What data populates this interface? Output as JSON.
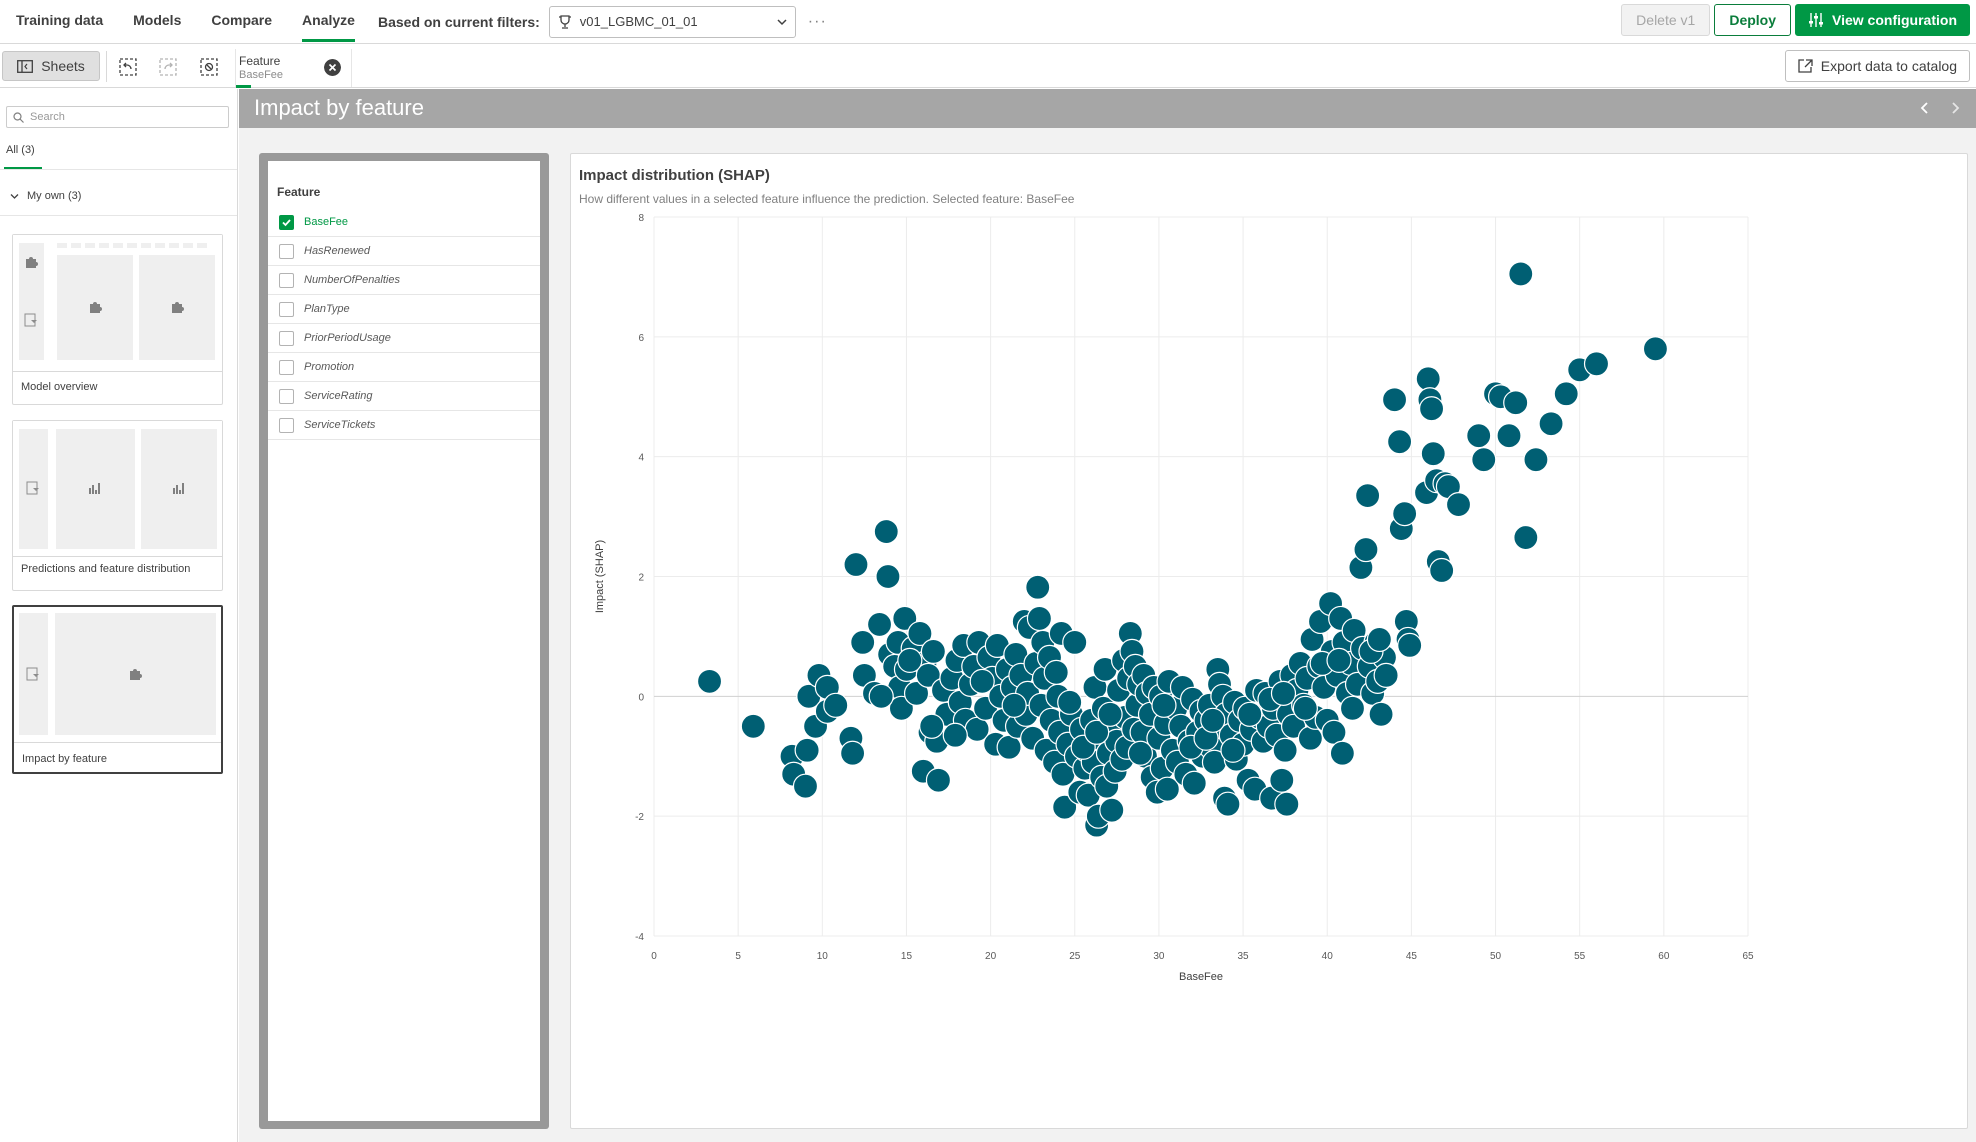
{
  "topbar": {
    "tabs": [
      "Training data",
      "Models",
      "Compare",
      "Analyze"
    ],
    "active_tab": "Analyze",
    "filter_label": "Based on current filters:",
    "filter_value": "v01_LGBMC_01_01",
    "more": "···",
    "delete_label": "Delete v1",
    "deploy_label": "Deploy",
    "view_config_label": "View configuration"
  },
  "subbar": {
    "sheets_label": "Sheets",
    "feature_tab_title": "Feature",
    "feature_tab_value": "BaseFee",
    "export_label": "Export data to catalog"
  },
  "sidebar": {
    "search_placeholder": "Search",
    "all_tab": "All (3)",
    "group_label": "My own (3)",
    "cards": [
      {
        "label": "Model overview"
      },
      {
        "label": "Predictions and feature distribution"
      },
      {
        "label": "Impact by feature"
      }
    ]
  },
  "page": {
    "title": "Impact by feature"
  },
  "feature_filter": {
    "title": "Feature",
    "items": [
      {
        "label": "BaseFee",
        "checked": true
      },
      {
        "label": "HasRenewed",
        "checked": false
      },
      {
        "label": "NumberOfPenalties",
        "checked": false
      },
      {
        "label": "PlanType",
        "checked": false
      },
      {
        "label": "PriorPeriodUsage",
        "checked": false
      },
      {
        "label": "Promotion",
        "checked": false
      },
      {
        "label": "ServiceRating",
        "checked": false
      },
      {
        "label": "ServiceTickets",
        "checked": false
      }
    ]
  },
  "chart": {
    "title": "Impact distribution (SHAP)",
    "subtitle": "How different values in a selected feature influence the prediction. Selected feature: BaseFee"
  },
  "colors": {
    "accent_green": "#009845",
    "point_color": "#005f73",
    "header_gray": "#a6a6a6"
  },
  "chart_data": {
    "type": "scatter",
    "title": "Impact distribution (SHAP)",
    "xlabel": "BaseFee",
    "ylabel": "Impact (SHAP)",
    "xlim": [
      0,
      65
    ],
    "ylim": [
      -4,
      8
    ],
    "xticks": [
      0,
      5,
      10,
      15,
      20,
      25,
      30,
      35,
      40,
      45,
      50,
      55,
      60,
      65
    ],
    "yticks": [
      -4,
      -2,
      0,
      2,
      4,
      6,
      8
    ],
    "grid": true,
    "series": [
      {
        "points": [
          [
            3.3,
            0.25
          ],
          [
            5.9,
            -0.5
          ],
          [
            8.2,
            -1.0
          ],
          [
            8.3,
            -1.3
          ],
          [
            9.0,
            -1.5
          ],
          [
            9.1,
            -0.9
          ],
          [
            9.2,
            0.0
          ],
          [
            9.6,
            -0.5
          ],
          [
            9.8,
            0.35
          ],
          [
            10.3,
            0.15
          ],
          [
            10.3,
            -0.25
          ],
          [
            10.8,
            -0.15
          ],
          [
            11.7,
            -0.7
          ],
          [
            11.8,
            -0.95
          ],
          [
            12.0,
            2.2
          ],
          [
            12.4,
            0.9
          ],
          [
            12.5,
            0.35
          ],
          [
            13.1,
            0.05
          ],
          [
            13.4,
            1.2
          ],
          [
            13.8,
            2.75
          ],
          [
            13.9,
            2.0
          ],
          [
            14.0,
            0.7
          ],
          [
            14.3,
            0.5
          ],
          [
            14.5,
            0.9
          ],
          [
            14.6,
            0.15
          ],
          [
            14.7,
            -0.2
          ],
          [
            14.9,
            1.3
          ],
          [
            15.0,
            0.45
          ],
          [
            15.4,
            0.8
          ],
          [
            15.6,
            0.05
          ],
          [
            15.8,
            1.05
          ],
          [
            16.0,
            -1.25
          ],
          [
            16.1,
            0.55
          ],
          [
            16.3,
            0.35
          ],
          [
            16.4,
            -0.6
          ],
          [
            16.6,
            0.75
          ],
          [
            16.8,
            -0.75
          ],
          [
            16.9,
            -1.4
          ],
          [
            17.2,
            0.1
          ],
          [
            17.4,
            -0.3
          ],
          [
            17.7,
            0.3
          ],
          [
            18.0,
            0.6
          ],
          [
            18.2,
            -0.1
          ],
          [
            18.4,
            0.85
          ],
          [
            18.5,
            -0.4
          ],
          [
            18.8,
            0.2
          ],
          [
            19.0,
            0.5
          ],
          [
            19.2,
            -0.55
          ],
          [
            19.3,
            0.9
          ],
          [
            19.7,
            -0.2
          ],
          [
            19.9,
            0.65
          ],
          [
            20.1,
            0.3
          ],
          [
            20.3,
            -0.8
          ],
          [
            20.4,
            0.85
          ],
          [
            20.6,
            0.0
          ],
          [
            20.8,
            -0.4
          ],
          [
            21.0,
            0.45
          ],
          [
            21.1,
            -0.85
          ],
          [
            21.3,
            0.15
          ],
          [
            21.5,
            0.7
          ],
          [
            21.6,
            -0.5
          ],
          [
            21.8,
            0.35
          ],
          [
            22.0,
            1.25
          ],
          [
            22.1,
            -0.3
          ],
          [
            22.2,
            0.05
          ],
          [
            22.3,
            1.15
          ],
          [
            22.5,
            -0.7
          ],
          [
            22.7,
            0.55
          ],
          [
            22.8,
            1.82
          ],
          [
            22.9,
            1.3
          ],
          [
            23.0,
            -0.15
          ],
          [
            23.1,
            0.9
          ],
          [
            23.2,
            0.3
          ],
          [
            23.3,
            -0.9
          ],
          [
            23.5,
            0.65
          ],
          [
            23.6,
            -0.4
          ],
          [
            23.8,
            -1.1
          ],
          [
            24.0,
            0.0
          ],
          [
            24.1,
            -0.6
          ],
          [
            24.2,
            1.05
          ],
          [
            24.3,
            -1.3
          ],
          [
            24.4,
            -1.85
          ],
          [
            24.6,
            -0.8
          ],
          [
            24.8,
            -0.3
          ],
          [
            25.0,
            0.9
          ],
          [
            25.1,
            -1.0
          ],
          [
            25.3,
            -1.6
          ],
          [
            25.4,
            -0.55
          ],
          [
            25.6,
            -1.2
          ],
          [
            25.7,
            -0.9
          ],
          [
            25.8,
            -1.65
          ],
          [
            26.0,
            -0.4
          ],
          [
            26.1,
            -1.1
          ],
          [
            26.2,
            0.15
          ],
          [
            26.3,
            -2.15
          ],
          [
            26.4,
            -2.0
          ],
          [
            26.5,
            -0.7
          ],
          [
            26.6,
            -1.35
          ],
          [
            26.7,
            -0.2
          ],
          [
            26.8,
            0.45
          ],
          [
            26.9,
            -1.5
          ],
          [
            27.0,
            -0.95
          ],
          [
            27.2,
            -1.9
          ],
          [
            27.3,
            -0.5
          ],
          [
            27.4,
            -1.25
          ],
          [
            27.5,
            -0.75
          ],
          [
            27.6,
            0.1
          ],
          [
            27.8,
            -1.05
          ],
          [
            27.9,
            0.6
          ],
          [
            28.0,
            -0.35
          ],
          [
            28.1,
            -0.85
          ],
          [
            28.2,
            0.3
          ],
          [
            28.3,
            1.05
          ],
          [
            28.4,
            0.75
          ],
          [
            28.5,
            -0.55
          ],
          [
            28.6,
            0.5
          ],
          [
            28.7,
            -0.15
          ],
          [
            28.8,
            0.2
          ],
          [
            29.0,
            -0.6
          ],
          [
            29.1,
            0.35
          ],
          [
            29.2,
            -1.0
          ],
          [
            29.3,
            0.05
          ],
          [
            29.5,
            -0.3
          ],
          [
            29.6,
            -1.35
          ],
          [
            29.7,
            0.15
          ],
          [
            29.9,
            -1.6
          ],
          [
            30.0,
            -0.7
          ],
          [
            30.1,
            0.0
          ],
          [
            30.2,
            -1.2
          ],
          [
            30.4,
            -0.45
          ],
          [
            30.5,
            -1.55
          ],
          [
            30.6,
            0.25
          ],
          [
            30.8,
            -0.9
          ],
          [
            31.0,
            -0.2
          ],
          [
            31.1,
            -1.1
          ],
          [
            31.3,
            -0.5
          ],
          [
            31.4,
            0.15
          ],
          [
            31.6,
            -1.3
          ],
          [
            31.8,
            -0.75
          ],
          [
            32.0,
            -0.05
          ],
          [
            32.1,
            -1.45
          ],
          [
            32.3,
            -0.6
          ],
          [
            32.5,
            -0.25
          ],
          [
            32.6,
            -1.0
          ],
          [
            32.8,
            -0.4
          ],
          [
            33.0,
            -0.15
          ],
          [
            33.1,
            -0.85
          ],
          [
            33.3,
            -1.1
          ],
          [
            33.5,
            0.45
          ],
          [
            33.6,
            0.2
          ],
          [
            33.7,
            -0.5
          ],
          [
            33.8,
            0.0
          ],
          [
            33.9,
            -1.7
          ],
          [
            34.0,
            -0.3
          ],
          [
            34.1,
            -1.8
          ],
          [
            34.3,
            -0.65
          ],
          [
            34.5,
            -0.1
          ],
          [
            34.6,
            -1.05
          ],
          [
            34.8,
            -0.4
          ],
          [
            35.0,
            -0.8
          ],
          [
            35.1,
            -0.2
          ],
          [
            35.3,
            -1.4
          ],
          [
            35.5,
            -0.55
          ],
          [
            35.7,
            -1.55
          ],
          [
            35.8,
            0.1
          ],
          [
            36.0,
            -0.35
          ],
          [
            36.2,
            -0.75
          ],
          [
            36.3,
            0.05
          ],
          [
            36.5,
            -0.5
          ],
          [
            36.7,
            -1.7
          ],
          [
            36.8,
            -0.2
          ],
          [
            37.0,
            -0.65
          ],
          [
            37.2,
            0.25
          ],
          [
            37.3,
            -1.4
          ],
          [
            37.5,
            -0.9
          ],
          [
            37.6,
            -1.8
          ],
          [
            37.7,
            -0.3
          ],
          [
            37.9,
            0.35
          ],
          [
            38.0,
            -0.5
          ],
          [
            38.2,
            0.1
          ],
          [
            38.4,
            0.55
          ],
          [
            38.6,
            -0.15
          ],
          [
            38.8,
            0.3
          ],
          [
            39.0,
            -0.7
          ],
          [
            39.1,
            0.95
          ],
          [
            39.3,
            -0.35
          ],
          [
            39.5,
            0.5
          ],
          [
            39.6,
            1.25
          ],
          [
            39.8,
            0.15
          ],
          [
            40.0,
            -0.4
          ],
          [
            40.2,
            1.55
          ],
          [
            40.3,
            0.75
          ],
          [
            40.4,
            -0.6
          ],
          [
            40.6,
            0.35
          ],
          [
            40.8,
            1.3
          ],
          [
            40.9,
            -0.95
          ],
          [
            41.0,
            0.9
          ],
          [
            41.2,
            0.05
          ],
          [
            41.4,
            0.55
          ],
          [
            41.6,
            1.1
          ],
          [
            41.8,
            0.2
          ],
          [
            42.0,
            2.15
          ],
          [
            42.1,
            0.8
          ],
          [
            42.3,
            2.45
          ],
          [
            42.4,
            3.35
          ],
          [
            42.5,
            0.5
          ],
          [
            42.7,
            0.05
          ],
          [
            42.9,
            0.9
          ],
          [
            43.0,
            0.25
          ],
          [
            43.2,
            -0.3
          ],
          [
            43.4,
            0.65
          ],
          [
            43.5,
            0.35
          ],
          [
            44.0,
            4.95
          ],
          [
            44.3,
            4.25
          ],
          [
            44.4,
            2.8
          ],
          [
            44.6,
            3.05
          ],
          [
            44.7,
            1.25
          ],
          [
            44.8,
            0.95
          ],
          [
            44.9,
            0.85
          ],
          [
            45.9,
            3.4
          ],
          [
            46.0,
            5.3
          ],
          [
            46.1,
            4.95
          ],
          [
            46.2,
            4.8
          ],
          [
            46.3,
            4.05
          ],
          [
            46.5,
            3.6
          ],
          [
            46.6,
            2.25
          ],
          [
            46.8,
            2.1
          ],
          [
            47.0,
            3.55
          ],
          [
            47.2,
            3.5
          ],
          [
            47.8,
            3.2
          ],
          [
            49.0,
            4.35
          ],
          [
            49.3,
            3.95
          ],
          [
            50.0,
            5.05
          ],
          [
            50.3,
            5.0
          ],
          [
            50.8,
            4.35
          ],
          [
            51.2,
            4.9
          ],
          [
            51.5,
            7.05
          ],
          [
            51.8,
            2.65
          ],
          [
            52.4,
            3.95
          ],
          [
            53.3,
            4.55
          ],
          [
            54.2,
            5.05
          ],
          [
            55.0,
            5.45
          ],
          [
            56.0,
            5.55
          ],
          [
            59.5,
            5.8
          ],
          [
            13.5,
            0.0
          ],
          [
            15.2,
            0.6
          ],
          [
            16.5,
            -0.5
          ],
          [
            17.9,
            -0.65
          ],
          [
            19.5,
            0.25
          ],
          [
            21.4,
            -0.15
          ],
          [
            23.9,
            0.4
          ],
          [
            24.7,
            -0.1
          ],
          [
            25.5,
            -0.85
          ],
          [
            26.3,
            -0.6
          ],
          [
            27.1,
            -0.3
          ],
          [
            28.9,
            -0.95
          ],
          [
            30.3,
            -0.15
          ],
          [
            31.9,
            -0.85
          ],
          [
            32.8,
            -0.7
          ],
          [
            33.2,
            -0.4
          ],
          [
            34.4,
            -0.9
          ],
          [
            35.4,
            -0.3
          ],
          [
            36.6,
            -0.05
          ],
          [
            37.4,
            0.05
          ],
          [
            38.7,
            -0.2
          ],
          [
            39.7,
            0.55
          ],
          [
            40.7,
            0.6
          ],
          [
            41.5,
            -0.2
          ],
          [
            42.6,
            0.75
          ],
          [
            43.1,
            0.95
          ]
        ]
      }
    ]
  }
}
